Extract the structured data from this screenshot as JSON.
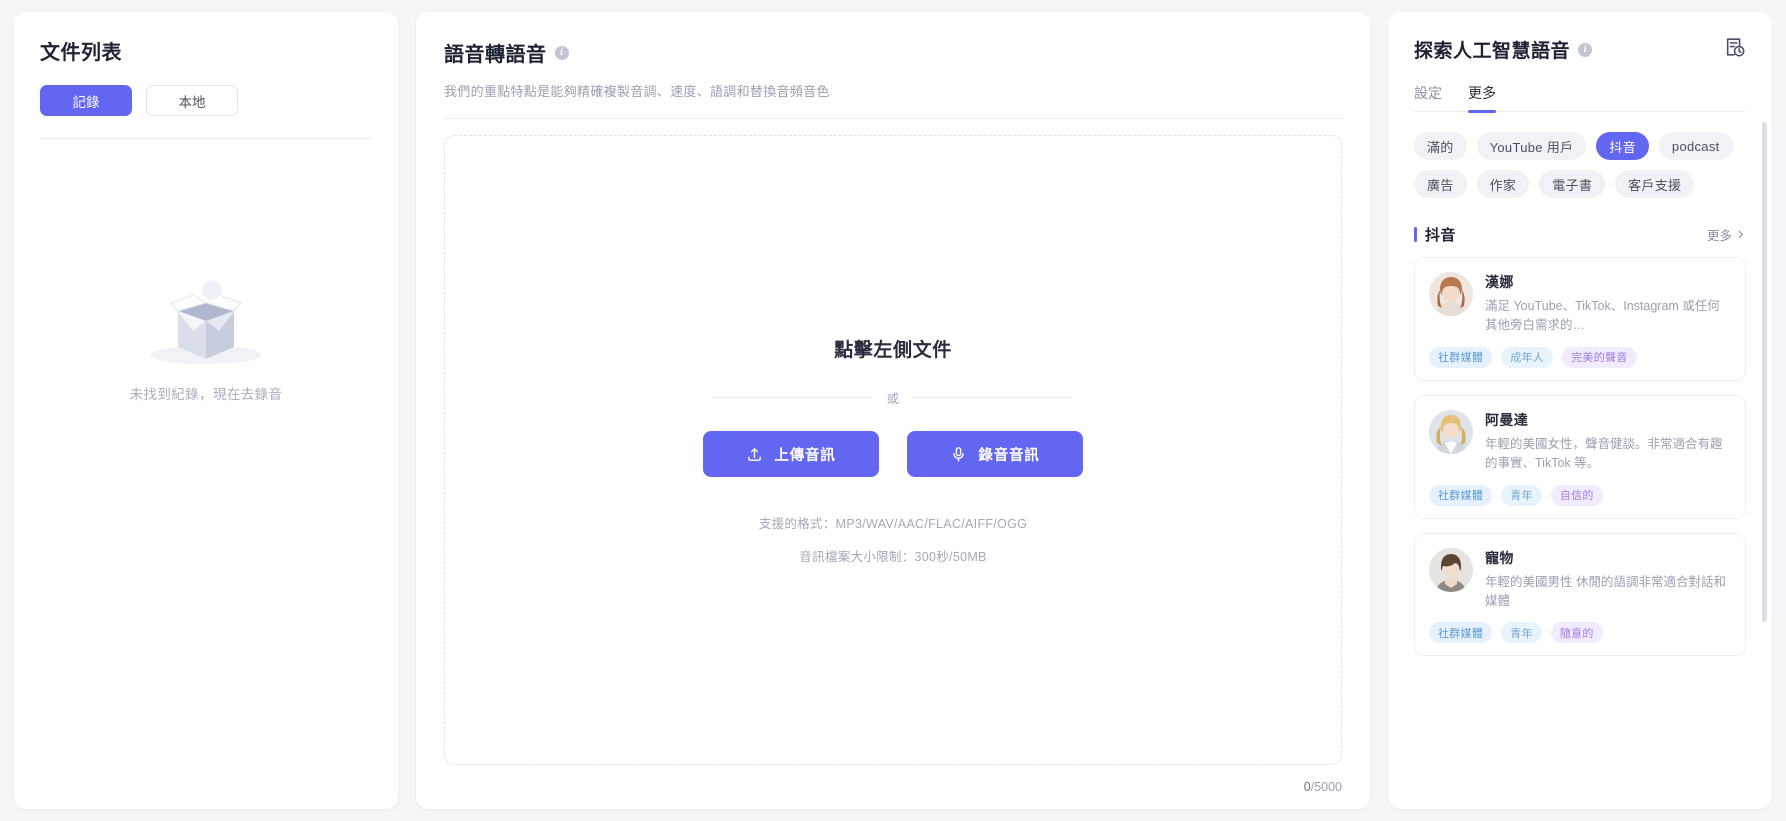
{
  "left_panel": {
    "title": "文件列表",
    "tabs": [
      {
        "label": "記錄",
        "active": true
      },
      {
        "label": "本地",
        "active": false
      }
    ],
    "empty_state": {
      "icon": "empty-box-search-icon",
      "text": "未找到紀錄，現在去錄音"
    }
  },
  "middle_panel": {
    "title": "語音轉語音",
    "info_icon": "info-icon",
    "info_glyph": "i",
    "subtitle": "我們的重點特點是能夠精確複製音調、速度、語調和替換音頻音色",
    "dropzone": {
      "heading": "點擊左側文件",
      "or_label": "或",
      "upload_button": {
        "label": "上傳音訊",
        "icon": "upload-icon"
      },
      "record_button": {
        "label": "錄音音訊",
        "icon": "microphone-icon"
      },
      "format_hint": "支援的格式：MP3/WAV/AAC/FLAC/AIFF/OGG",
      "size_hint": "音訊檔案大小限制：300秒/50MB"
    },
    "counter": {
      "current": "0",
      "max": "/5000"
    }
  },
  "right_panel": {
    "title": "探索人工智慧語音",
    "info_icon": "info-icon",
    "info_glyph": "i",
    "history_icon": "history-document-icon",
    "tabs": [
      {
        "label": "設定",
        "active": false
      },
      {
        "label": "更多",
        "active": true
      }
    ],
    "chips": [
      {
        "label": "滿的",
        "active": false
      },
      {
        "label": "YouTube 用戶",
        "active": false
      },
      {
        "label": "抖音",
        "active": true
      },
      {
        "label": "podcast",
        "active": false
      },
      {
        "label": "廣告",
        "active": false
      },
      {
        "label": "作家",
        "active": false
      },
      {
        "label": "電子書",
        "active": false
      },
      {
        "label": "客戶支援",
        "active": false
      }
    ],
    "section": {
      "title": "抖音",
      "more_label": "更多",
      "more_icon": "chevron-right-icon"
    },
    "voices": [
      {
        "name": "漢娜",
        "description": "滿足 YouTube、TikTok、Instagram 或任何其他旁白需求的…",
        "tags": [
          "社群媒體",
          "成年人",
          "完美的聲音"
        ],
        "avatar": "female-avatar-1"
      },
      {
        "name": "阿曼達",
        "description": "年輕的美國女性，聲音健談。非常適合有趣的事實、TikTok 等。",
        "tags": [
          "社群媒體",
          "青年",
          "自信的"
        ],
        "avatar": "female-avatar-2"
      },
      {
        "name": "寵物",
        "description": "年輕的美國男性 休閒的語調非常適合對話和媒體",
        "tags": [
          "社群媒體",
          "青年",
          "隨意的"
        ],
        "avatar": "male-avatar-1"
      }
    ]
  },
  "colors": {
    "accent": "#6366f1",
    "page_bg": "#f5f6f8",
    "panel_bg": "#ffffff",
    "muted_text": "#9ba0b2"
  }
}
